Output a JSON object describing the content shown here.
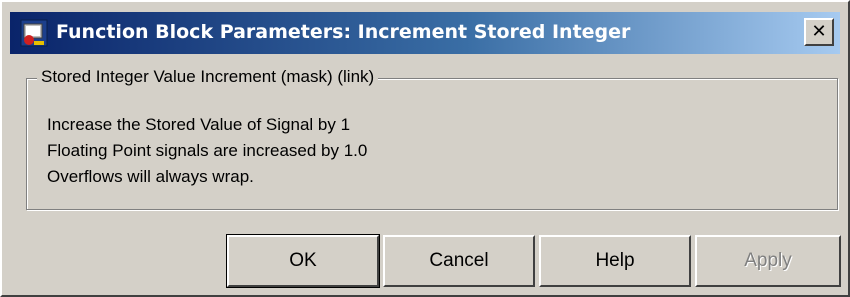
{
  "window": {
    "title": "Function Block Parameters: Increment Stored Integer",
    "close_glyph": "✕",
    "icon": "simulink-block-icon",
    "accent_color": "#0a246a"
  },
  "group": {
    "legend": "Stored Integer Value Increment (mask) (link)",
    "lines": [
      "Increase the Stored Value of Signal by 1",
      "Floating Point signals are increased by 1.0",
      "Overflows will always wrap."
    ]
  },
  "buttons": {
    "ok": "OK",
    "cancel": "Cancel",
    "help": "Help",
    "apply": "Apply"
  }
}
